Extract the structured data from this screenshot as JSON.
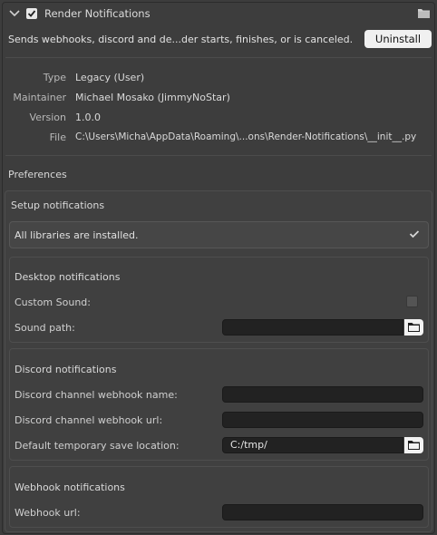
{
  "header": {
    "title": "Render Notifications",
    "enabled": true,
    "description": "Sends webhooks, discord and de...der starts, finishes, or is canceled.",
    "uninstall_label": "Uninstall"
  },
  "info": [
    {
      "label": "Type",
      "value": "Legacy (User)"
    },
    {
      "label": "Maintainer",
      "value": "Michael Mosako (JimmyNoStar)"
    },
    {
      "label": "Version",
      "value": "1.0.0"
    },
    {
      "label": "File",
      "value": "C:\\Users\\Micha\\AppData\\Roaming\\...ons\\Render-Notifications\\__init__.py"
    }
  ],
  "preferences_label": "Preferences",
  "setup": {
    "title": "Setup notifications",
    "libraries_status": "All libraries are installed."
  },
  "desktop": {
    "title": "Desktop notifications",
    "custom_sound_label": "Custom Sound:",
    "custom_sound_checked": false,
    "sound_path_label": "Sound path:",
    "sound_path_value": ""
  },
  "discord": {
    "title": "Discord notifications",
    "webhook_name_label": "Discord channel webhook name:",
    "webhook_name_value": "",
    "webhook_url_label": "Discord channel webhook url:",
    "webhook_url_value": "",
    "save_location_label": "Default temporary save location:",
    "save_location_value": "C:/tmp/"
  },
  "webhook": {
    "title": "Webhook notifications",
    "url_label": "Webhook url:",
    "url_value": ""
  },
  "colors": {
    "background": "#3d3d3d",
    "field": "#222222",
    "button": "#f0f0f0"
  }
}
